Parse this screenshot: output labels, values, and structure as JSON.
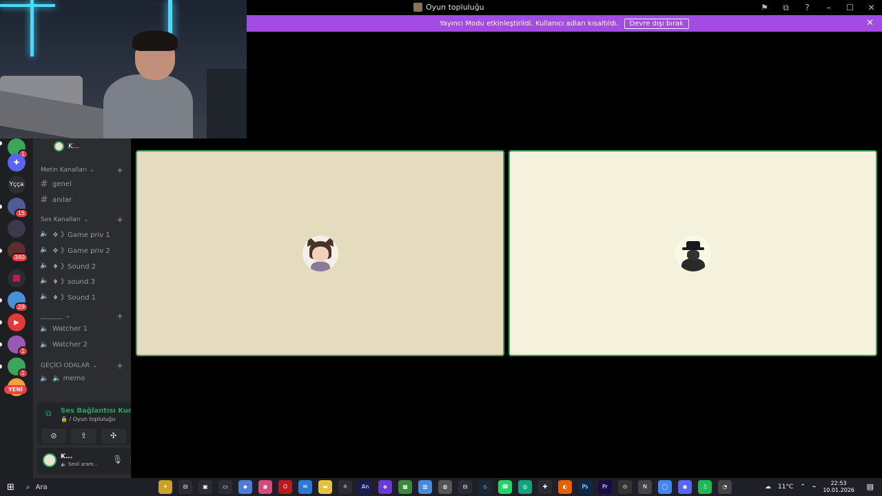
{
  "window": {
    "title": "Oyun topluluğu",
    "controls": [
      "⚑",
      "⧉",
      "?",
      "–",
      "☐",
      "✕"
    ]
  },
  "banner": {
    "message": "Yayıncı Modu etkinleştirildi. Kullanıcı adları kısaltıldı.",
    "button": "Devre dışı bırak",
    "close": "✕"
  },
  "rail": {
    "servers": [
      {
        "label": "",
        "color": "#3ba55c",
        "badge": "1"
      },
      {
        "label": "✚",
        "color": "#5865f2",
        "badge": ""
      },
      {
        "label": "Yçça",
        "color": "#2b2d31",
        "badge": ""
      },
      {
        "label": "",
        "color": "#4e5d94",
        "badge": "15"
      },
      {
        "label": "",
        "color": "#3a3a4a",
        "badge": ""
      },
      {
        "label": "",
        "color": "#5c2e2e",
        "badge": "340"
      },
      {
        "label": "",
        "color": "#c2185b",
        "badge": ""
      },
      {
        "label": "",
        "color": "#4a90d9",
        "badge": "29"
      },
      {
        "label": "▶",
        "color": "#e53935",
        "badge": ""
      },
      {
        "label": "",
        "color": "#9b59b6",
        "badge": "1"
      },
      {
        "label": "",
        "color": "#3ba55c",
        "badge": "1"
      },
      {
        "label": "",
        "color": "#f0a33a",
        "badge": ""
      }
    ],
    "new_label": "YENİ"
  },
  "sidebar": {
    "top_user": "K...",
    "text_category": "Metin Kanalları",
    "text_channels": [
      "genel",
      "anılar"
    ],
    "voice_category": "Ses Kanalları",
    "voice_channels": [
      "❖ 》Game priv 1",
      "❖ 》Game priv 2",
      "♦ 》Sound 2",
      "♦ 》sound 3",
      "♦ 》Sound 1"
    ],
    "blank_category": "_______",
    "watcher_channels": [
      "Watcher 1",
      "Watcher 2"
    ],
    "temp_category": "GEÇİCİ ODALAR",
    "temp_channels": [
      "🔈 memo"
    ]
  },
  "voice_panel": {
    "status": "Ses Bağlantısı Kuru",
    "location": "🔒 / Oyun topluluğu"
  },
  "user_panel": {
    "name": "K...",
    "status": "🔈 Sesli aram..."
  },
  "taskbar": {
    "search_placeholder": "Ara",
    "weather": "11°C",
    "time": "22:53",
    "date": "10.01.2026",
    "apps": [
      {
        "label": "✦",
        "color": "#c9a227"
      },
      {
        "label": "⊟",
        "color": "#2b2b33"
      },
      {
        "label": "▣",
        "color": "#2b2b33"
      },
      {
        "label": "▭",
        "color": "#2b2b33"
      },
      {
        "label": "◆",
        "color": "#4a7dd8"
      },
      {
        "label": "◉",
        "color": "#d44a7a"
      },
      {
        "label": "O",
        "color": "#b71c1c"
      },
      {
        "label": "✉",
        "color": "#2a7ad8"
      },
      {
        "label": "▬",
        "color": "#e6c23a"
      },
      {
        "label": "⚛",
        "color": "#2b2b33"
      },
      {
        "label": "An",
        "color": "#1a1a55"
      },
      {
        "label": "◈",
        "color": "#6a3ad8"
      },
      {
        "label": "▦",
        "color": "#3a8a3a"
      },
      {
        "label": "▥",
        "color": "#4a8ad8"
      },
      {
        "label": "◍",
        "color": "#555"
      },
      {
        "label": "⊟",
        "color": "#2b2b33"
      },
      {
        "label": "♨",
        "color": "#1b2838"
      },
      {
        "label": "☎",
        "color": "#25d366"
      },
      {
        "label": "◎",
        "color": "#10a37f"
      },
      {
        "label": "✚",
        "color": "#2b2b33"
      },
      {
        "label": "◐",
        "color": "#e66000"
      },
      {
        "label": "Ps",
        "color": "#0a2a4a"
      },
      {
        "label": "Pr",
        "color": "#1a0a4a"
      },
      {
        "label": "⊙",
        "color": "#333"
      },
      {
        "label": "N",
        "color": "#444"
      },
      {
        "label": "◯",
        "color": "#4285f4"
      },
      {
        "label": "◉",
        "color": "#5865f2"
      },
      {
        "label": "♫",
        "color": "#1db954"
      },
      {
        "label": "◔",
        "color": "#444"
      }
    ]
  }
}
